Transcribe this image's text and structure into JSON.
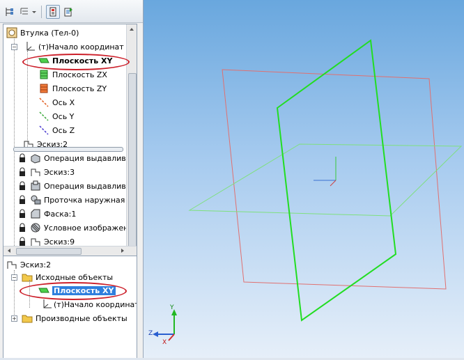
{
  "tree1": {
    "items": [
      {
        "label": "Втулка (Тел-0)",
        "icon": "part-icon"
      },
      {
        "label": "(т)Начало координат",
        "icon": "origin-icon"
      },
      {
        "label": "Плоскость XY",
        "icon": "plane-xy-icon"
      },
      {
        "label": "Плоскость ZX",
        "icon": "plane-zx-icon"
      },
      {
        "label": "Плоскость ZY",
        "icon": "plane-zy-icon"
      },
      {
        "label": "Ось X",
        "icon": "axis-x-icon"
      },
      {
        "label": "Ось Y",
        "icon": "axis-y-icon"
      },
      {
        "label": "Ось Z",
        "icon": "axis-z-icon"
      },
      {
        "label": "Эскиз:2",
        "icon": "sketch-icon"
      },
      {
        "label": "Операция выдавлив",
        "icon": "extrude-icon"
      },
      {
        "label": "Эскиз:3",
        "icon": "sketch-icon"
      },
      {
        "label": "Операция выдавлив",
        "icon": "extrude-icon"
      },
      {
        "label": "Проточка наружная",
        "icon": "groove-icon"
      },
      {
        "label": "Фаска:1",
        "icon": "chamfer-icon"
      },
      {
        "label": "Условное изображен",
        "icon": "thread-icon"
      },
      {
        "label": "Эскиз:9",
        "icon": "sketch-icon"
      }
    ]
  },
  "tree2": {
    "items": [
      {
        "label": "Эскиз:2",
        "icon": "sketch-icon"
      },
      {
        "label": "Исходные объекты",
        "icon": "folder-icon"
      },
      {
        "label": "Плоскость XY",
        "icon": "plane-xy-icon"
      },
      {
        "label": "(т)Начало координат",
        "icon": "origin-icon"
      },
      {
        "label": "Производные объекты",
        "icon": "folder-icon"
      }
    ]
  },
  "triad": {
    "x": "X",
    "y": "Y",
    "z": "Z"
  },
  "colors": {
    "selection": "#2f7fdd",
    "annotation_ellipse": "#cc1f2a",
    "plane_green": "#22dd22",
    "plane_red": "#e07070",
    "plane_light_green": "#7fe07f"
  }
}
